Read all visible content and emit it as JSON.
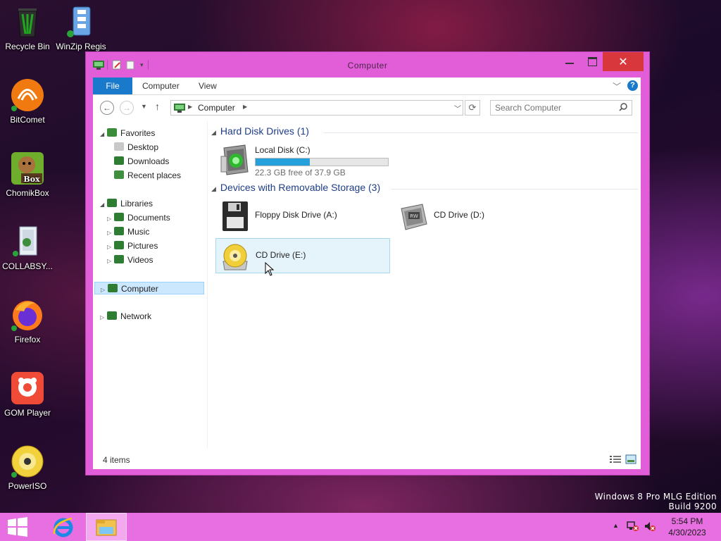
{
  "desktop": {
    "icons": [
      {
        "label": "Recycle Bin"
      },
      {
        "label": "WinZip Regis"
      },
      {
        "label": "BitComet"
      },
      {
        "label": "ChomikBox"
      },
      {
        "label": "COLLABSY..."
      },
      {
        "label": "Firefox"
      },
      {
        "label": "GOM Player"
      },
      {
        "label": "PowerISO"
      }
    ],
    "chomikbox_badge": "Box",
    "watermark": {
      "line1": "Windows 8 Pro MLG Edition",
      "line2": "Build 9200"
    }
  },
  "window": {
    "title": "Computer",
    "close_glyph": "✕",
    "tabs": [
      {
        "label": "File"
      },
      {
        "label": "Computer"
      },
      {
        "label": "View"
      }
    ],
    "help_glyph": "?",
    "address": {
      "location": "Computer"
    },
    "search": {
      "placeholder": "Search Computer"
    },
    "nav": {
      "favorites": "Favorites",
      "desktop": "Desktop",
      "downloads": "Downloads",
      "recent": "Recent places",
      "libraries": "Libraries",
      "documents": "Documents",
      "music": "Music",
      "pictures": "Pictures",
      "videos": "Videos",
      "computer": "Computer",
      "network": "Network"
    },
    "groups": {
      "hdd": "Hard Disk Drives (1)",
      "removable": "Devices with Removable Storage (3)"
    },
    "drives": {
      "c": {
        "name": "Local Disk (C:)",
        "free_text": "22.3 GB free of 37.9 GB",
        "used_fraction": 0.41
      },
      "a": {
        "name": "Floppy Disk Drive (A:)"
      },
      "d": {
        "name": "CD Drive (D:)",
        "badge": "RW"
      },
      "e": {
        "name": "CD Drive (E:)"
      }
    },
    "status": {
      "item_count": "4 items"
    }
  },
  "taskbar": {
    "time": "5:54 PM",
    "date": "4/30/2023"
  },
  "colors": {
    "window_frame": "#e25ed8",
    "taskbar": "#e86fe2",
    "accent": "#1979ca",
    "close": "#d8373c"
  }
}
